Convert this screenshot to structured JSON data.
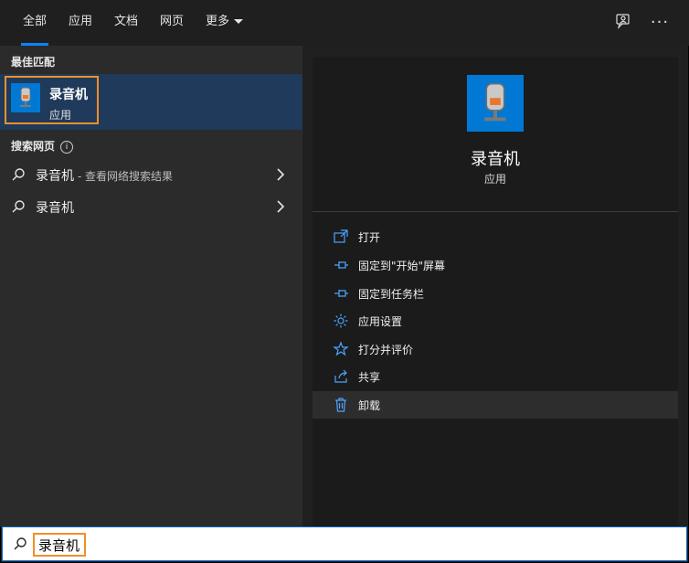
{
  "tabs": [
    {
      "label": "全部",
      "active": true
    },
    {
      "label": "应用"
    },
    {
      "label": "文档"
    },
    {
      "label": "网页"
    },
    {
      "label": "更多"
    }
  ],
  "top_icons": [
    "feedback-icon",
    "more-options-icon"
  ],
  "left": {
    "best_match_heading": "最佳匹配",
    "best_match": {
      "name": "录音机",
      "type": "应用",
      "icon": "voice-recorder-app-icon"
    },
    "web_heading": "搜索网页",
    "web_results": [
      {
        "label": "录音机",
        "suffix": " - 查看网络搜索结果"
      },
      {
        "label": "录音机",
        "suffix": ""
      }
    ]
  },
  "detail": {
    "title": "录音机",
    "subtitle": "应用",
    "actions": [
      {
        "label": "打开",
        "icon": "open-icon"
      },
      {
        "label": "固定到\"开始\"屏幕",
        "icon": "pin-icon"
      },
      {
        "label": "固定到任务栏",
        "icon": "pin-icon"
      },
      {
        "label": "应用设置",
        "icon": "gear-icon"
      },
      {
        "label": "打分并评价",
        "icon": "star-icon"
      },
      {
        "label": "共享",
        "icon": "share-icon"
      },
      {
        "label": "卸载",
        "icon": "trash-icon"
      }
    ]
  },
  "search": {
    "value": "录音机"
  },
  "colors": {
    "accent": "#0078d4",
    "highlight_border": "#f0902a",
    "selected_bg": "#1f3a5a"
  }
}
